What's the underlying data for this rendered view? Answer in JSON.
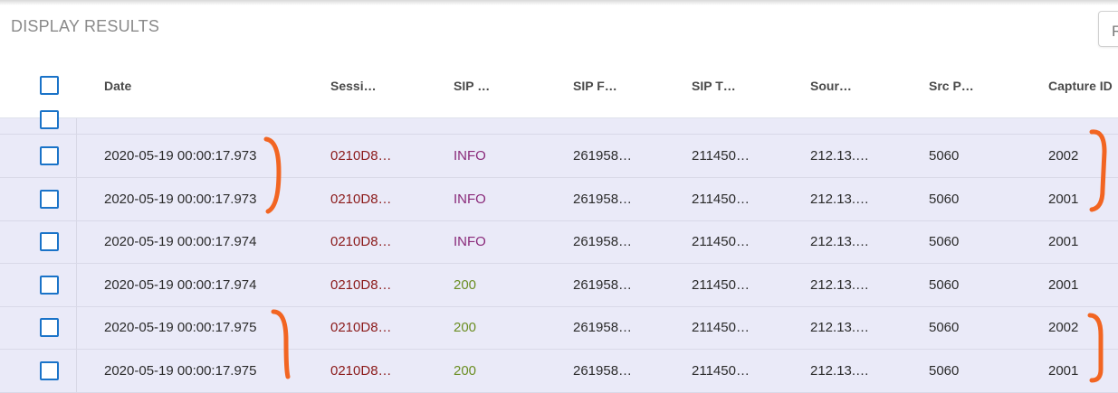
{
  "page": {
    "title": "DISPLAY RESULTS",
    "top_button_label": "R"
  },
  "table": {
    "columns": [
      "Date",
      "Sessi…",
      "SIP …",
      "SIP F…",
      "SIP T…",
      "Sour…",
      "Src P…",
      "Capture ID"
    ],
    "rows": [
      {
        "date": "2020-05-19 00:00:17.973",
        "session": "0210D8…",
        "method": "INFO",
        "from": "261958…",
        "to": "211450…",
        "source": "212.13.…",
        "src_port": "5060",
        "capture_id": "2002"
      },
      {
        "date": "2020-05-19 00:00:17.973",
        "session": "0210D8…",
        "method": "INFO",
        "from": "261958…",
        "to": "211450…",
        "source": "212.13.…",
        "src_port": "5060",
        "capture_id": "2001"
      },
      {
        "date": "2020-05-19 00:00:17.974",
        "session": "0210D8…",
        "method": "INFO",
        "from": "261958…",
        "to": "211450…",
        "source": "212.13.…",
        "src_port": "5060",
        "capture_id": "2001"
      },
      {
        "date": "2020-05-19 00:00:17.974",
        "session": "0210D8…",
        "method": "200",
        "from": "261958…",
        "to": "211450…",
        "source": "212.13.…",
        "src_port": "5060",
        "capture_id": "2001"
      },
      {
        "date": "2020-05-19 00:00:17.975",
        "session": "0210D8…",
        "method": "200",
        "from": "261958…",
        "to": "211450…",
        "source": "212.13.…",
        "src_port": "5060",
        "capture_id": "2002"
      },
      {
        "date": "2020-05-19 00:00:17.975",
        "session": "0210D8…",
        "method": "200",
        "from": "261958…",
        "to": "211450…",
        "source": "212.13.…",
        "src_port": "5060",
        "capture_id": "2001"
      }
    ]
  },
  "colors": {
    "accent": "#1a73c8",
    "row_background": "#eaeaf8",
    "session_text": "#8b1a1a",
    "method_info": "#8a2a7a",
    "method_200": "#6b8e23",
    "annotation": "#f26522"
  },
  "icons": {
    "select_all": "checkbox-icon",
    "row_select": "checkbox-icon",
    "annotation": "orange-bracket"
  }
}
